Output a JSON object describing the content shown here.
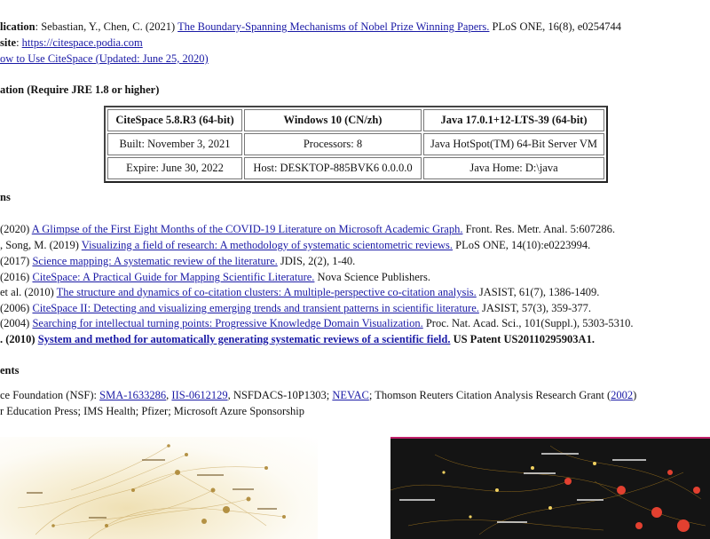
{
  "publication": {
    "label": "lication",
    "text": ": Sebastian, Y., Chen, C. (2021) ",
    "link": "The Boundary-Spanning Mechanisms of Nobel Prize Winning Papers.",
    "rest": " PLoS ONE, 16(8), e0254744"
  },
  "website": {
    "label": "site",
    "colon": ": ",
    "link": "https://citespace.podia.com"
  },
  "howto": {
    "link": "ow to Use CiteSpace (Updated: June 25, 2020)"
  },
  "installation_heading": "ation (Require JRE 1.8 or higher)",
  "info_table": {
    "row1": [
      "CiteSpace 5.8.R3 (64-bit)",
      "Windows 10 (CN/zh)",
      "Java 17.0.1+12-LTS-39 (64-bit)"
    ],
    "row2": [
      "Built: November 3, 2021",
      "Processors: 8",
      "Java HotSpot(TM) 64-Bit Server VM"
    ],
    "row3": [
      "Expire: June 30, 2022",
      "Host: DESKTOP-885BVK6 0.0.0.0",
      "Java Home: D:\\java"
    ]
  },
  "publications_heading": "ns",
  "references": [
    {
      "pre": "(2020) ",
      "link": "A Glimpse of the First Eight Months of the COVID-19 Literature on Microsoft Academic Graph.",
      "post": " Front. Res. Metr. Anal. 5:607286."
    },
    {
      "pre": ", Song, M. (2019) ",
      "link": "Visualizing a field of research: A methodology of systematic scientometric reviews.",
      "post": " PLoS ONE, 14(10):e0223994."
    },
    {
      "pre": "(2017) ",
      "link": "Science mapping: A systematic review of the literature.",
      "post": " JDIS, 2(2), 1-40."
    },
    {
      "pre": "(2016) ",
      "link": "CiteSpace: A Practical Guide for Mapping Scientific Literature.",
      "post": " Nova Science Publishers."
    },
    {
      "pre": " et al. (2010) ",
      "link": "The structure and dynamics of co-citation clusters: A multiple-perspective co-citation analysis.",
      "post": " JASIST, 61(7), 1386-1409."
    },
    {
      "pre": "(2006) ",
      "link": "CiteSpace II: Detecting and visualizing emerging trends and transient patterns in scientific literature.",
      "post": " JASIST, 57(3), 359-377."
    },
    {
      "pre": "(2004) ",
      "link": "Searching for intellectual turning points: Progressive Knowledge Domain Visualization.",
      "post": " Proc. Nat. Acad. Sci., 101(Suppl.), 5303-5310."
    },
    {
      "pre": ". (2010) ",
      "link": "System and method for automatically generating systematic reviews of a scientific field.",
      "post": " US Patent US20110295903A1."
    }
  ],
  "acknowledgements_heading": "ents",
  "funding": {
    "pre": "ce Foundation (NSF): ",
    "link1": "SMA-1633286",
    "sep1": ", ",
    "link2": "IIS-0612129",
    "mid": ", NSFDACS-10P1303; ",
    "link3": "NEVAC",
    "post": "; Thomson Reuters Citation Analysis Research Grant (",
    "link4": "2002",
    "end": ")"
  },
  "sponsors": "r Education Press; IMS Health; Pfizer; Microsoft Azure Sponsorship"
}
